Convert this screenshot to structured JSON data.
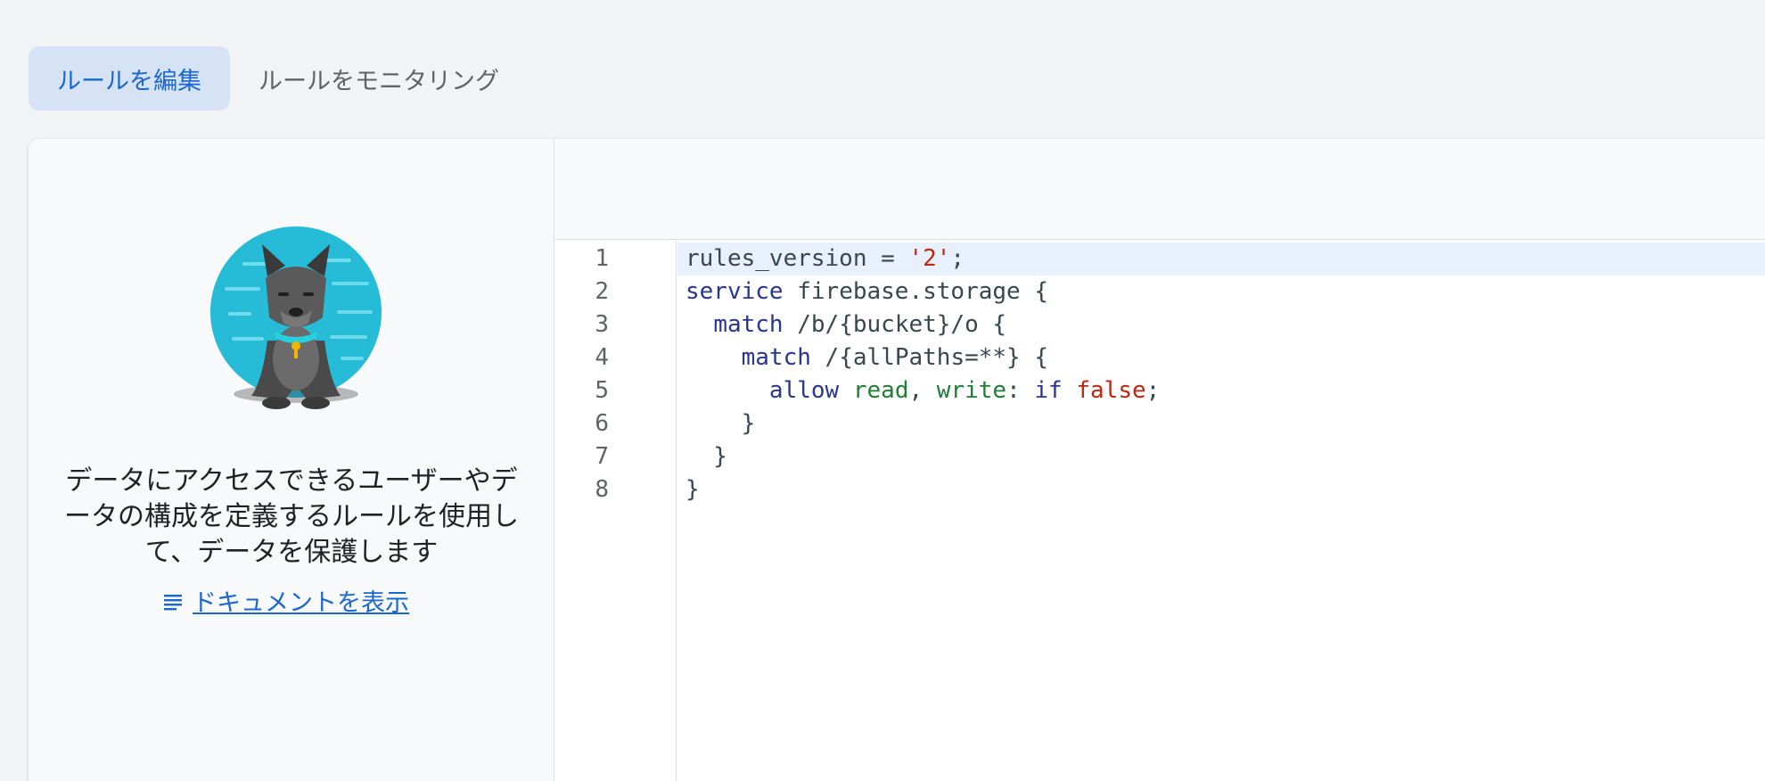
{
  "tabs": [
    {
      "label": "ルールを編集",
      "active": true
    },
    {
      "label": "ルールをモニタリング",
      "active": false
    }
  ],
  "left_panel": {
    "description": "データにアクセスできるユーザーやデータの構成を定義するルールを使用して、データを保護します",
    "doc_link_icon": "list-icon",
    "doc_link_label": "ドキュメントを表示",
    "illustration": "dog-mascot-illustration"
  },
  "editor": {
    "line_numbers": [
      "1",
      "2",
      "3",
      "4",
      "5",
      "6",
      "7",
      "8"
    ],
    "lines": [
      "rules_version = '2';",
      "service firebase.storage {",
      "  match /b/{bucket}/o {",
      "    match /{allPaths=**} {",
      "      allow read, write: if false;",
      "    }",
      "  }",
      "}"
    ]
  },
  "colors": {
    "accent": "#1a67d2",
    "active_tab_bg": "#d6e3f5",
    "keyword": "#283593",
    "string": "#c2260f",
    "permission": "#1e7e34"
  }
}
